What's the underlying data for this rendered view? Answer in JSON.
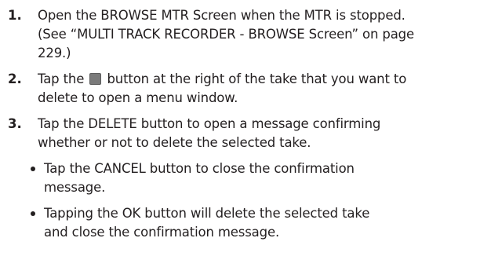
{
  "steps": [
    {
      "number": "1.",
      "line1": "Open the BROWSE MTR Screen when the MTR is stopped.",
      "line2": "(See “MULTI TRACK RECORDER - BROWSE Screen” on page",
      "line3": "229.)"
    },
    {
      "number": "2.",
      "line1_before": "Tap the",
      "line1_after": "button at the right of the take that you want to",
      "line2": "delete to open a menu window.",
      "icon": "menu-button-icon"
    },
    {
      "number": "3.",
      "line1": "Tap the DELETE button to open a message confirming",
      "line2": "whether or not to delete the selected take.",
      "bullets": [
        {
          "line1": "Tap the CANCEL button to close the confirmation",
          "line2": "message."
        },
        {
          "line1": "Tapping the OK button will delete the selected take",
          "line2": "and close the confirmation message."
        }
      ]
    }
  ]
}
